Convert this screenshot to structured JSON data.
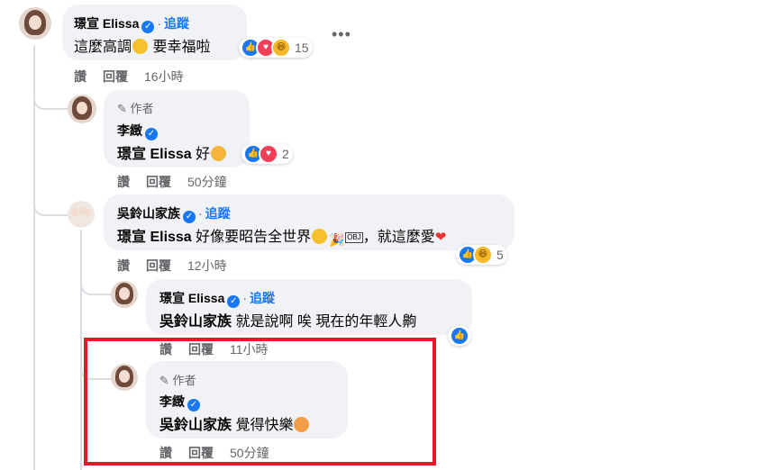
{
  "comments": [
    {
      "name": "璟宣 Elissa",
      "follow": "追蹤",
      "text": "這麼高調",
      "text_after": "要幸福啦",
      "reaction_count": "15",
      "actions": {
        "like": "讚",
        "reply": "回覆",
        "time": "16小時"
      }
    },
    {
      "author_badge": "作者",
      "name": "李緻",
      "mention": "璟宣 Elissa",
      "text": "好",
      "reaction_count": "2",
      "actions": {
        "like": "讚",
        "reply": "回覆",
        "time": "50分鐘"
      }
    },
    {
      "name": "吳鈴山家族",
      "follow": "追蹤",
      "mention": "璟宣 Elissa",
      "text": "好像要昭告全世界",
      "obj": "OBJ",
      "text_after": "，就這麼愛",
      "reaction_count": "5",
      "actions": {
        "like": "讚",
        "reply": "回覆",
        "time": "12小時"
      }
    },
    {
      "name": "璟宣 Elissa",
      "follow": "追蹤",
      "mention": "吳鈴山家族",
      "text": "就是說啊 唉 現在的年輕人齁",
      "actions": {
        "like": "讚",
        "reply": "回覆",
        "time": "11小時"
      }
    },
    {
      "author_badge": "作者",
      "name": "李緻",
      "mention": "吳鈴山家族",
      "text": "覺得快樂",
      "actions": {
        "like": "讚",
        "reply": "回覆",
        "time": "50分鐘"
      }
    }
  ],
  "more_options": "•••",
  "colors": {
    "link": "#1877f2",
    "bubble": "#f0f2f5",
    "highlight": "#e8182a",
    "meta": "#65676b"
  }
}
